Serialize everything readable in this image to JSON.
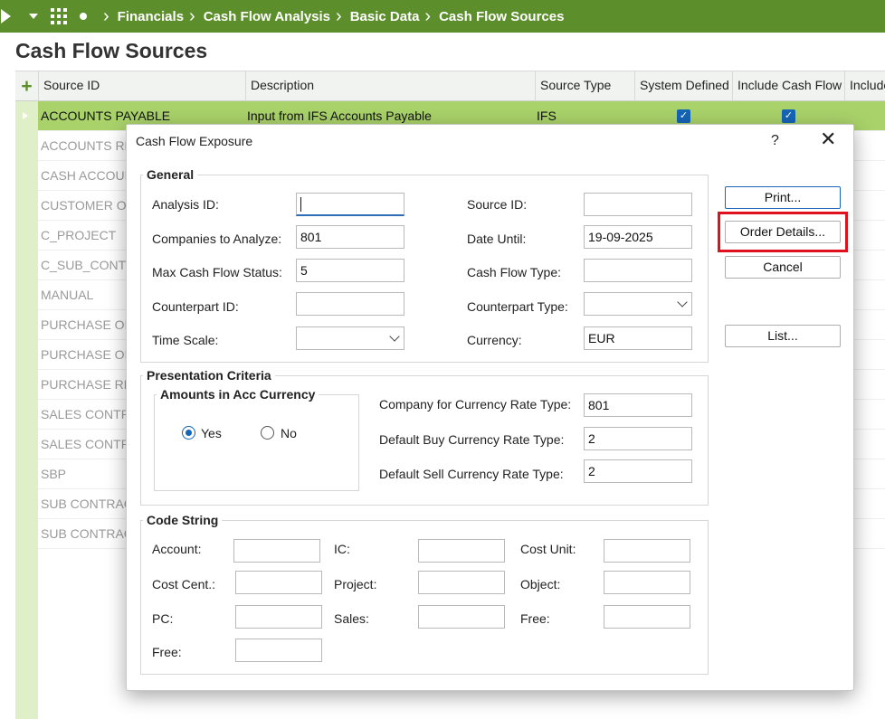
{
  "breadcrumb": [
    "Financials",
    "Cash Flow Analysis",
    "Basic Data",
    "Cash Flow Sources"
  ],
  "page_title": "Cash Flow Sources",
  "columns": [
    "Source ID",
    "Description",
    "Source Type",
    "System Defined",
    "Include Cash Flow",
    "Include"
  ],
  "rows": [
    {
      "id": "ACCOUNTS PAYABLE",
      "desc": "Input from IFS Accounts Payable",
      "type": "IFS"
    },
    {
      "id": "ACCOUNTS RE"
    },
    {
      "id": "CASH ACCOUN"
    },
    {
      "id": "CUSTOMER O"
    },
    {
      "id": "C_PROJECT"
    },
    {
      "id": "C_SUB_CONT"
    },
    {
      "id": "MANUAL"
    },
    {
      "id": "PURCHASE OF"
    },
    {
      "id": "PURCHASE OF"
    },
    {
      "id": "PURCHASE RE"
    },
    {
      "id": "SALES CONTR"
    },
    {
      "id": "SALES CONTR"
    },
    {
      "id": "SBP"
    },
    {
      "id": "SUB CONTRAC"
    },
    {
      "id": "SUB CONTRAC"
    }
  ],
  "dialog": {
    "title": "Cash Flow Exposure",
    "help": "?",
    "close": "✕",
    "general": {
      "label": "General",
      "analysis_id": {
        "label": "Analysis ID:",
        "value": ""
      },
      "companies": {
        "label": "Companies to Analyze:",
        "value": "801"
      },
      "max_status": {
        "label": "Max Cash Flow Status:",
        "value": "5"
      },
      "counterpart_id": {
        "label": "Counterpart ID:",
        "value": ""
      },
      "time_scale": {
        "label": "Time Scale:",
        "value": ""
      },
      "source_id": {
        "label": "Source ID:",
        "value": ""
      },
      "date_until": {
        "label": "Date Until:",
        "value": "19-09-2025"
      },
      "cf_type": {
        "label": "Cash Flow Type:",
        "value": ""
      },
      "counterpart_type": {
        "label": "Counterpart Type:",
        "value": ""
      },
      "currency": {
        "label": "Currency:",
        "value": "EUR"
      }
    },
    "presentation": {
      "label": "Presentation Criteria",
      "amounts_label": "Amounts in Acc Currency",
      "yes": "Yes",
      "no": "No",
      "company_rate": {
        "label": "Company for Currency Rate Type:",
        "value": "801"
      },
      "buy_rate": {
        "label": "Default Buy Currency Rate Type:",
        "value": "2"
      },
      "sell_rate": {
        "label": "Default Sell Currency Rate Type:",
        "value": "2"
      }
    },
    "code_string": {
      "label": "Code String",
      "account": "Account:",
      "ic": "IC:",
      "cost_unit": "Cost Unit:",
      "cost_cent": "Cost Cent.:",
      "project": "Project:",
      "object": "Object:",
      "pc": "PC:",
      "sales": "Sales:",
      "free1": "Free:",
      "free2": "Free:"
    },
    "buttons": {
      "print": "Print...",
      "order_details": "Order Details...",
      "cancel": "Cancel",
      "list": "List..."
    }
  },
  "colors": {
    "topbar": "#5c8e2b",
    "selected_row": "#a9d26a",
    "highlight": "#e0101c",
    "accent": "#1565b5"
  }
}
